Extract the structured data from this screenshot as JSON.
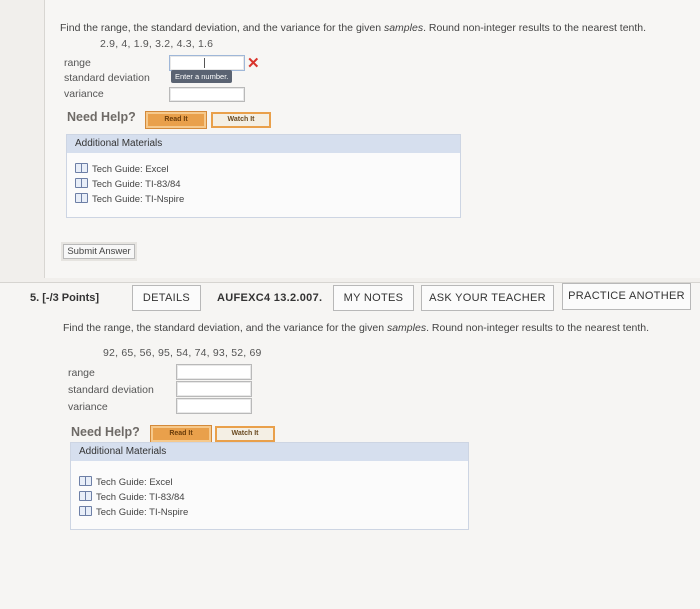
{
  "question4": {
    "prompt_prefix": "Find the range, the standard deviation, and the variance for the given ",
    "prompt_emphasis": "samples",
    "prompt_suffix": ". Round non-integer results to the nearest tenth.",
    "samples": "2.9, 4, 1.9, 3.2, 4.3, 1.6",
    "fields": [
      {
        "label": "range",
        "value": "",
        "tooltip": "Enter a number.",
        "error": true
      },
      {
        "label": "standard deviation",
        "value": ""
      },
      {
        "label": "variance",
        "value": ""
      }
    ],
    "need_help": "Need Help?",
    "read_it": "Read It",
    "watch_it": "Watch It",
    "materials_title": "Additional Materials",
    "materials": [
      "Tech Guide: Excel",
      "Tech Guide: TI-83/84",
      "Tech Guide: TI-Nspire"
    ],
    "submit_label": "Submit Answer",
    "error_mark": "✕"
  },
  "question5": {
    "number": "5.",
    "points": "[-/3 Points]",
    "details_label": "DETAILS",
    "code": "AUFEXC4 13.2.007.",
    "my_notes_label": "MY NOTES",
    "ask_teacher_label": "ASK YOUR TEACHER",
    "practice_label": "PRACTICE ANOTHER",
    "prompt_prefix": "Find the range, the standard deviation, and the variance for the given ",
    "prompt_emphasis": "samples",
    "prompt_suffix": ". Round non-integer results to the nearest tenth.",
    "samples": "92, 65, 56, 95, 54, 74, 93, 52, 69",
    "fields": [
      {
        "label": "range",
        "value": ""
      },
      {
        "label": "standard deviation",
        "value": ""
      },
      {
        "label": "variance",
        "value": ""
      }
    ],
    "need_help": "Need Help?",
    "read_it": "Read It",
    "watch_it": "Watch It",
    "materials_title": "Additional Materials",
    "materials": [
      "Tech Guide: Excel",
      "Tech Guide: TI-83/84",
      "Tech Guide: TI-Nspire"
    ]
  },
  "colors": {
    "error": "#d9342b",
    "help_button": "#e9a04b",
    "materials_header": "#d6dfee",
    "tooltip_bg": "#5a6372"
  }
}
